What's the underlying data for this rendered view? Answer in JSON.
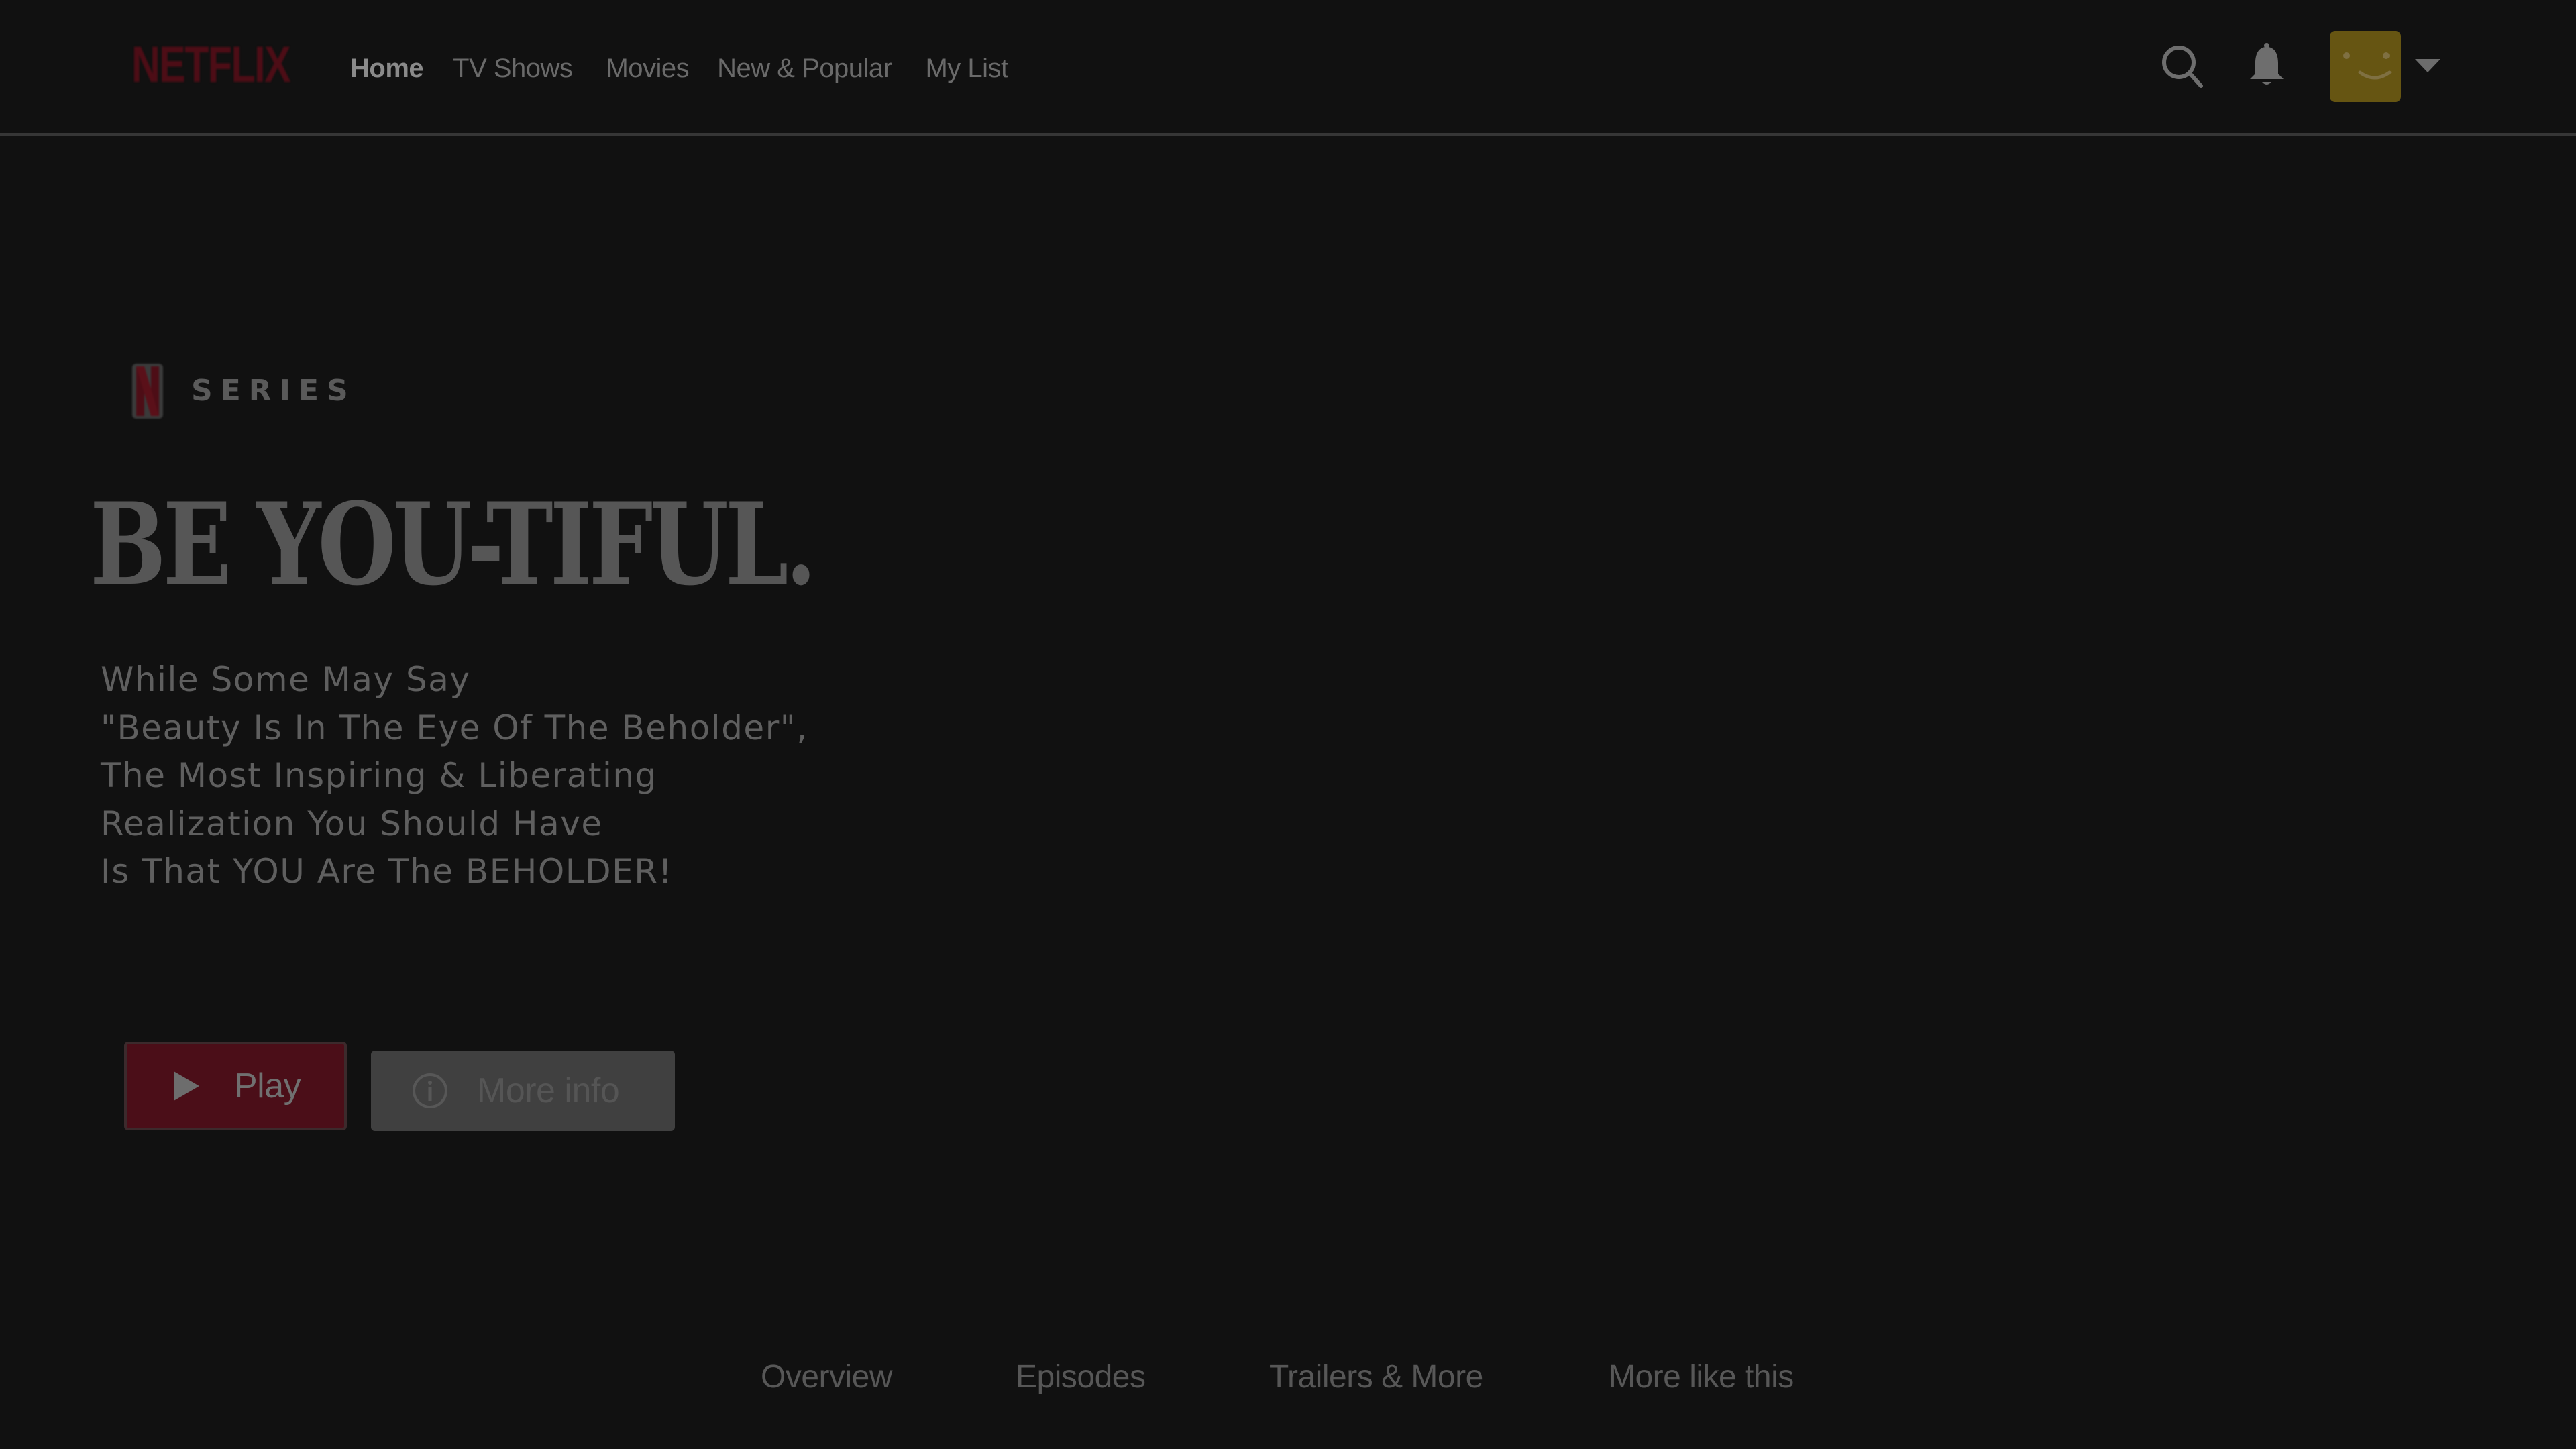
{
  "app": {
    "brand": "NETFLIX",
    "brand_color": "#4d0d16",
    "background_color": "#111111"
  },
  "header": {
    "nav": [
      {
        "label": "Home",
        "active": true
      },
      {
        "label": "TV Shows",
        "active": false
      },
      {
        "label": "Movies",
        "active": false
      },
      {
        "label": "New & Popular",
        "active": false
      },
      {
        "label": "My List",
        "active": false
      }
    ],
    "icons": {
      "search": "search-icon",
      "notifications": "bell-icon",
      "avatar": "smiley-avatar",
      "profile_menu": "caret-down-icon"
    },
    "avatar_color": "#665512"
  },
  "hero": {
    "badge": {
      "logo_letter": "N",
      "label": "SERIES"
    },
    "title": "BE YOU-TIFUL.",
    "description_lines": [
      "While Some May Say",
      "\"Beauty Is In The Eye Of The Beholder\",",
      "The Most Inspiring & Liberating",
      "Realization You Should Have",
      "Is That YOU Are The BEHOLDER!"
    ],
    "buttons": {
      "play": {
        "label": "Play",
        "icon": "play-icon",
        "color": "#4b0e18"
      },
      "more_info": {
        "label": "More info",
        "icon": "info-icon",
        "color": "#404040"
      }
    }
  },
  "tabs": [
    {
      "label": "Overview"
    },
    {
      "label": "Episodes"
    },
    {
      "label": "Trailers & More"
    },
    {
      "label": "More like this"
    }
  ]
}
